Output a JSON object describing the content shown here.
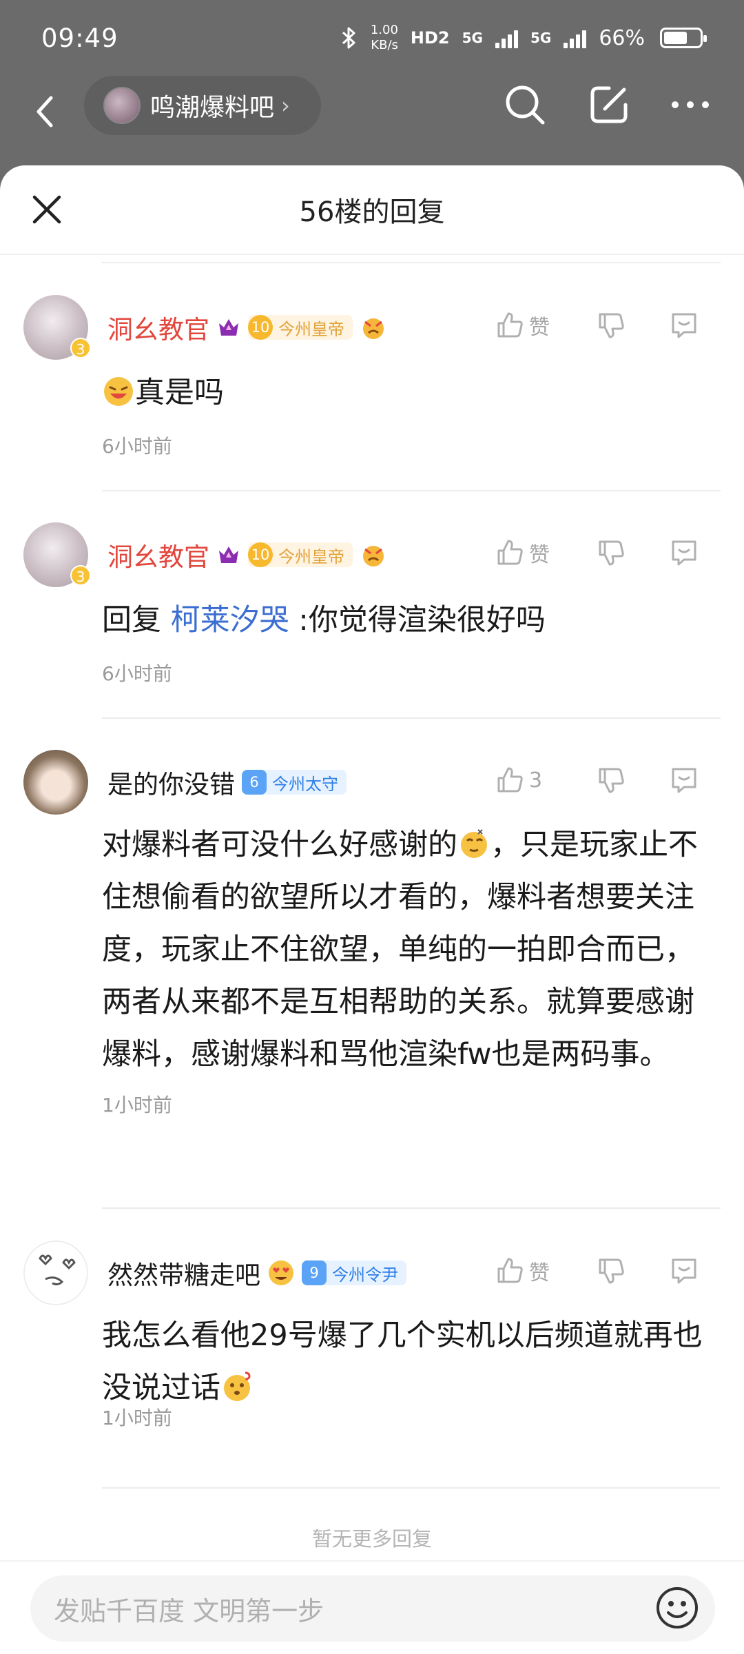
{
  "status_bar": {
    "time": "09:49",
    "net_speed_top": "1.00",
    "net_speed_bottom": "KB/s",
    "hd": "HD2",
    "sig1": "5G",
    "sig2": "5G",
    "battery": "66%",
    "battery_level": 0.66
  },
  "nav": {
    "forum_name": "鸣潮爆料吧"
  },
  "sheet": {
    "title": "56楼的回复"
  },
  "comments": [
    {
      "name": "洞幺教官",
      "level": "10",
      "level_title": "今州皇帝",
      "avatar_badge": "3",
      "like_label": "赞",
      "text": "真是吗",
      "time": "6小时前"
    },
    {
      "name": "洞幺教官",
      "level": "10",
      "level_title": "今州皇帝",
      "avatar_badge": "3",
      "like_label": "赞",
      "reply_prefix": "回复",
      "reply_to": "柯莱汐哭",
      "text": ":你觉得渲染很好吗",
      "time": "6小时前"
    },
    {
      "name": "是的你没错",
      "level": "6",
      "level_title": "今州太守",
      "like_label": "3",
      "text_a": "对爆料者可没什么好感谢的",
      "text_b": "，只是玩家止不住想偷看的欲望所以才看的，爆料者想要关注度，玩家止不住欲望，单纯的一拍即合而已，两者从来都不是互相帮助的关系。就算要感谢爆料，感谢爆料和骂他渲染fw也是两码事。",
      "time": "1小时前"
    },
    {
      "name": "然然带糖走吧",
      "level": "9",
      "level_title": "今州令尹",
      "like_label": "赞",
      "text": "我怎么看他29号爆了几个实机以后频道就再也没说过话",
      "time": "1小时前"
    }
  ],
  "footer": {
    "no_more": "暂无更多回复",
    "input_placeholder": "发贴千百度 文明第一步"
  }
}
